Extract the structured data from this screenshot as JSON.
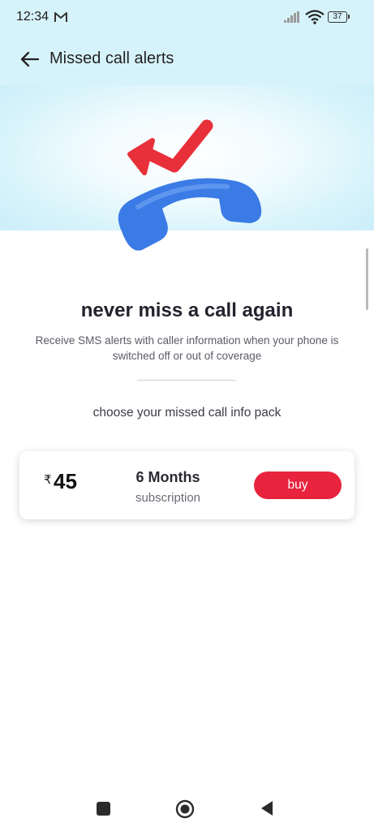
{
  "status_bar": {
    "time": "12:34",
    "mail_icon": "gmail-icon",
    "signal_icon": "cellular-signal-icon",
    "wifi_icon": "wifi-icon",
    "battery_level": "37"
  },
  "header": {
    "back_icon": "arrow-left-icon",
    "title": "Missed call alerts"
  },
  "hero": {
    "illustration": "missed-call-phone-icon",
    "colors": {
      "arrow": "#e8303a",
      "phone": "#3a7be6",
      "background": "#d6f3fb"
    }
  },
  "main": {
    "headline": "never miss a call again",
    "description": "Receive SMS alerts with caller information when your phone is switched off or out of coverage",
    "pack_prompt": "choose your missed call info pack"
  },
  "pack": {
    "currency_symbol": "₹",
    "price": "45",
    "duration": "6 Months",
    "plan_type": "subscription",
    "buy_label": "buy",
    "accent_color": "#e8233d"
  },
  "nav_bar": {
    "recents_icon": "square-icon",
    "home_icon": "circle-home-icon",
    "back_icon": "triangle-back-icon"
  }
}
